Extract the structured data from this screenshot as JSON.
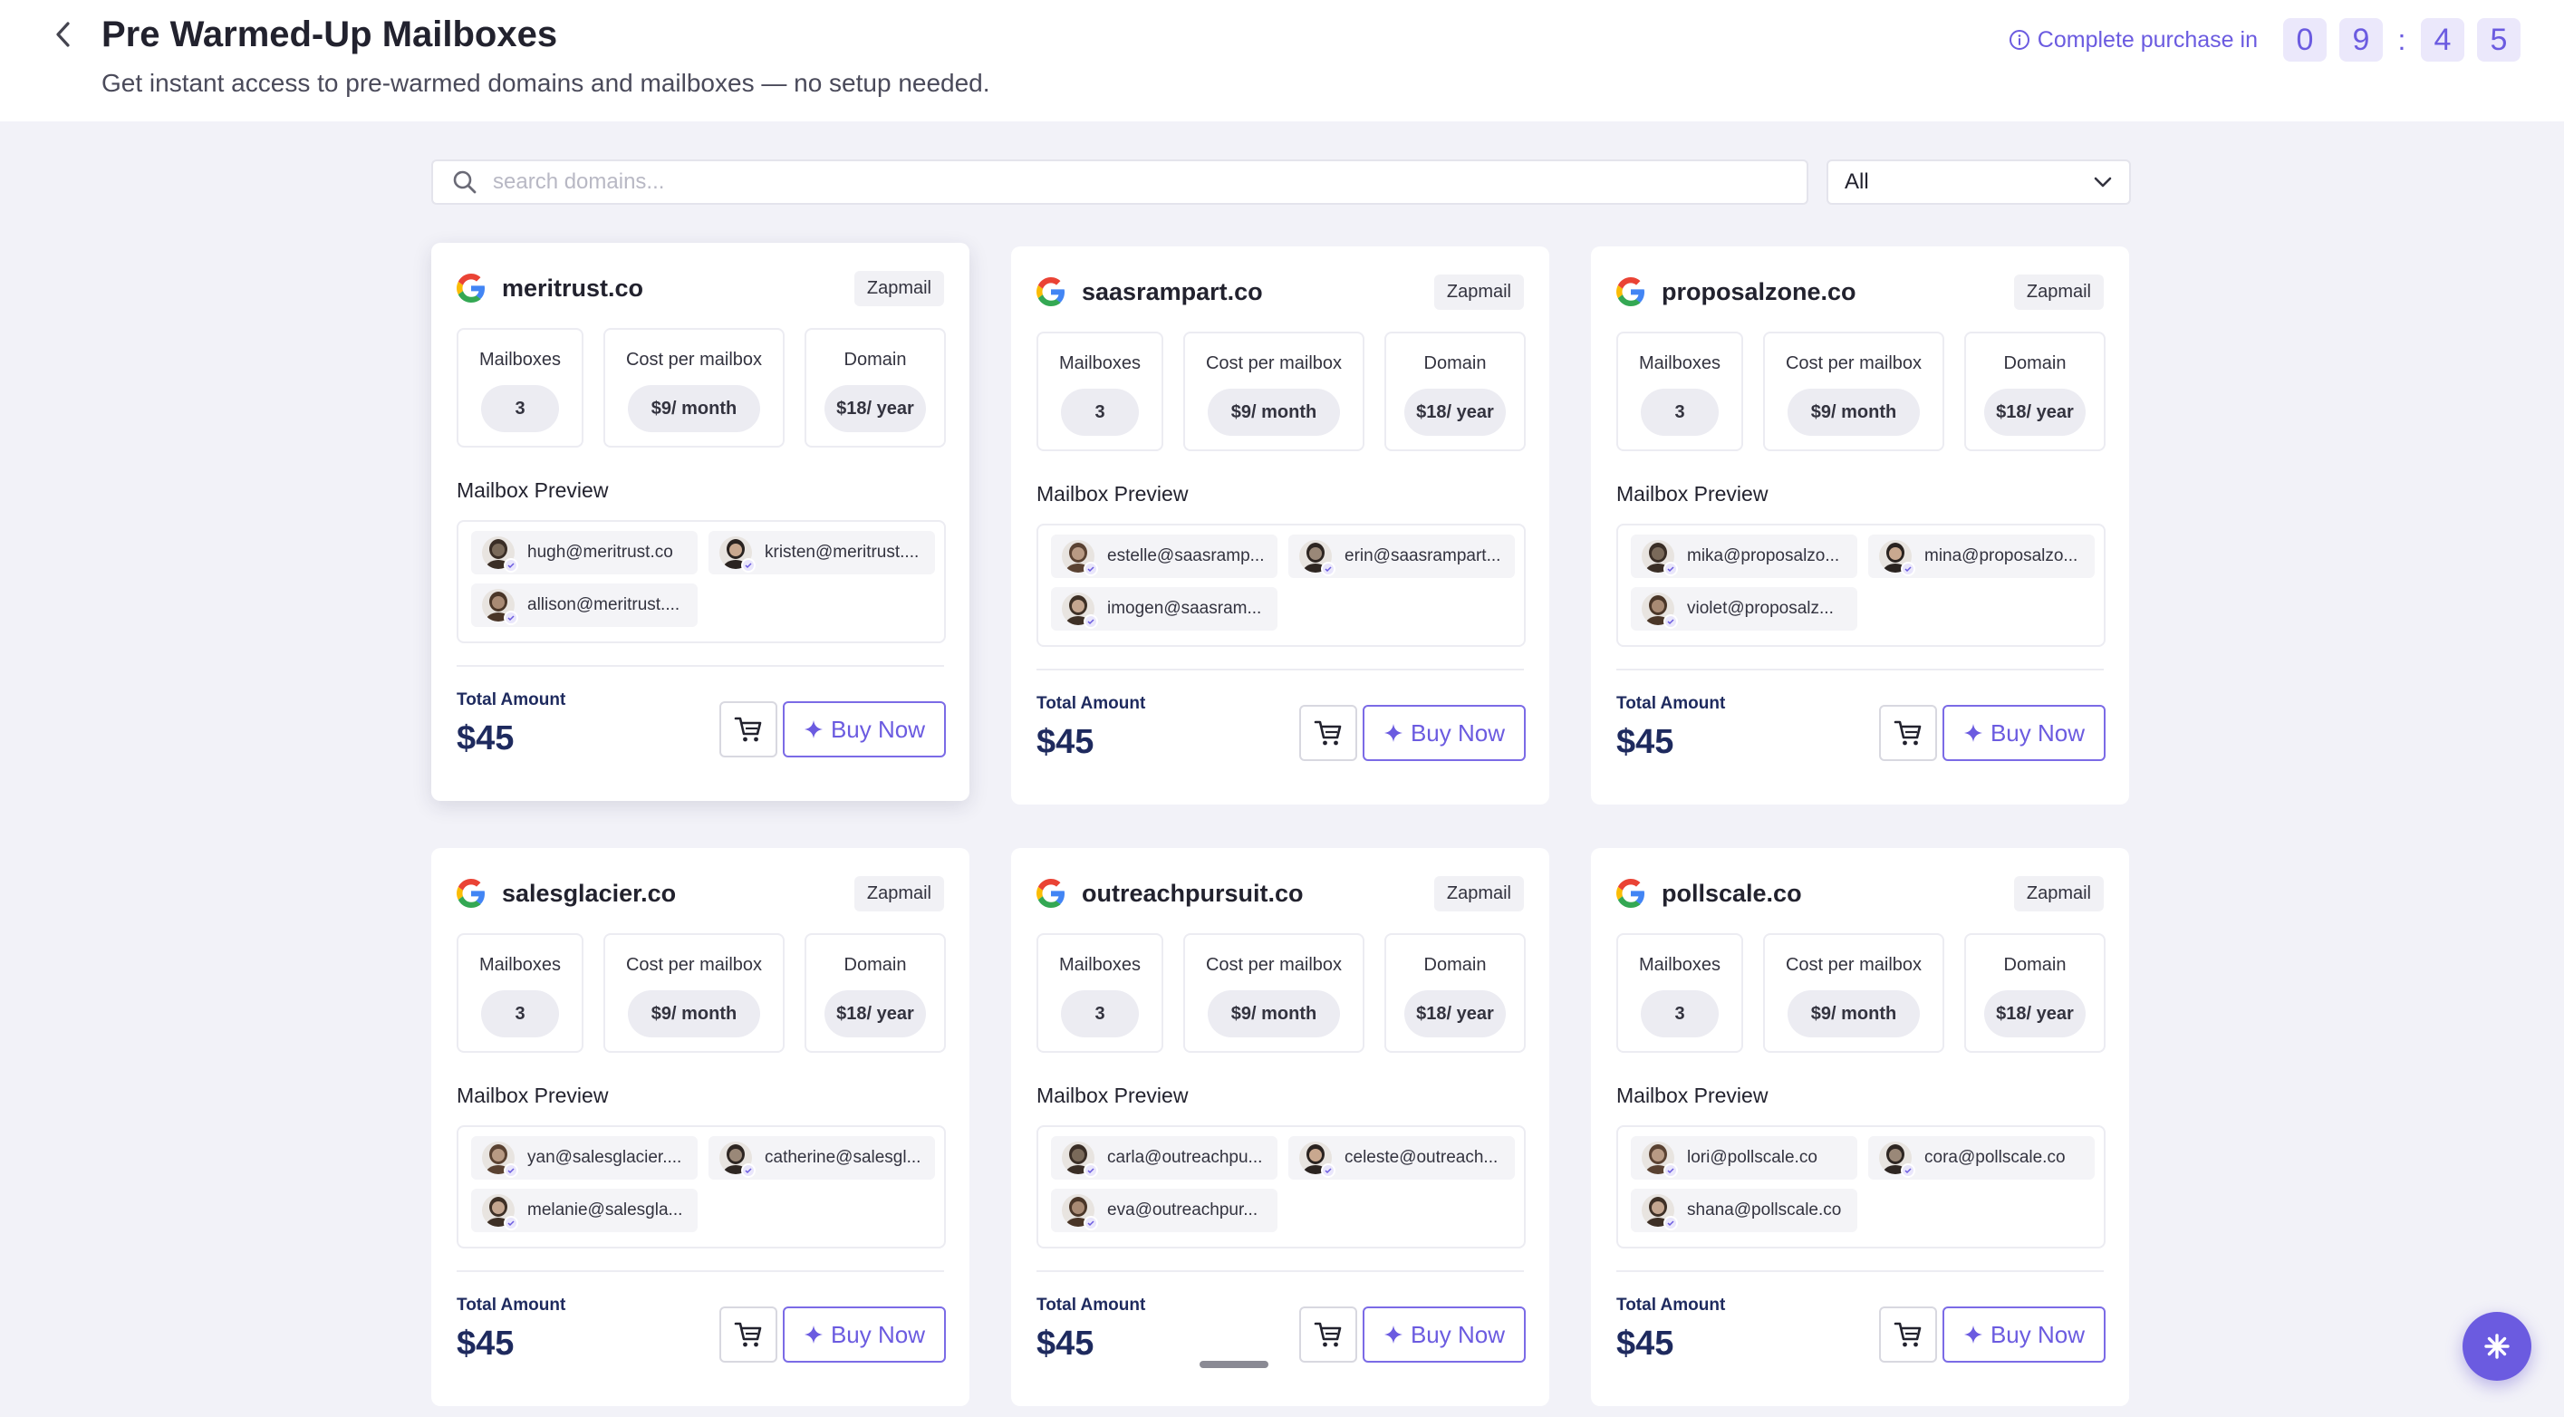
{
  "header": {
    "title": "Pre Warmed-Up Mailboxes",
    "subtitle": "Get instant access to pre-warmed domains and mailboxes — no setup needed.",
    "timer_label": "Complete purchase in",
    "timer_digits": [
      "0",
      "9",
      "4",
      "5"
    ],
    "timer_separator": ":"
  },
  "search": {
    "placeholder": "search domains..."
  },
  "filter": {
    "selected": "All"
  },
  "labels": {
    "mailboxes": "Mailboxes",
    "cost_per_mailbox": "Cost per mailbox",
    "domain": "Domain",
    "mailbox_preview": "Mailbox Preview",
    "total_amount": "Total Amount",
    "buy_now": "Buy Now"
  },
  "colors": {
    "accent": "#6b5be0",
    "total": "#1e2a5e",
    "background": "#f2f2f8"
  },
  "cards": [
    {
      "domain": "meritrust.co",
      "provider": "Zapmail",
      "mailboxes": "3",
      "cost": "$9/ month",
      "domain_price": "$18/ year",
      "total": "$45",
      "emails": [
        "hugh@meritrust.co",
        "kristen@meritrust....",
        "allison@meritrust...."
      ]
    },
    {
      "domain": "saasrampart.co",
      "provider": "Zapmail",
      "mailboxes": "3",
      "cost": "$9/ month",
      "domain_price": "$18/ year",
      "total": "$45",
      "emails": [
        "estelle@saasramp...",
        "erin@saasrampart...",
        "imogen@saasram..."
      ]
    },
    {
      "domain": "proposalzone.co",
      "provider": "Zapmail",
      "mailboxes": "3",
      "cost": "$9/ month",
      "domain_price": "$18/ year",
      "total": "$45",
      "emails": [
        "mika@proposalzo...",
        "mina@proposalzo...",
        "violet@proposalz..."
      ]
    },
    {
      "domain": "salesglacier.co",
      "provider": "Zapmail",
      "mailboxes": "3",
      "cost": "$9/ month",
      "domain_price": "$18/ year",
      "total": "$45",
      "emails": [
        "yan@salesglacier....",
        "catherine@salesgl...",
        "melanie@salesgla..."
      ]
    },
    {
      "domain": "outreachpursuit.co",
      "provider": "Zapmail",
      "mailboxes": "3",
      "cost": "$9/ month",
      "domain_price": "$18/ year",
      "total": "$45",
      "emails": [
        "carla@outreachpu...",
        "celeste@outreach...",
        "eva@outreachpur..."
      ]
    },
    {
      "domain": "pollscale.co",
      "provider": "Zapmail",
      "mailboxes": "3",
      "cost": "$9/ month",
      "domain_price": "$18/ year",
      "total": "$45",
      "emails": [
        "lori@pollscale.co",
        "cora@pollscale.co",
        "shana@pollscale.co"
      ]
    }
  ]
}
